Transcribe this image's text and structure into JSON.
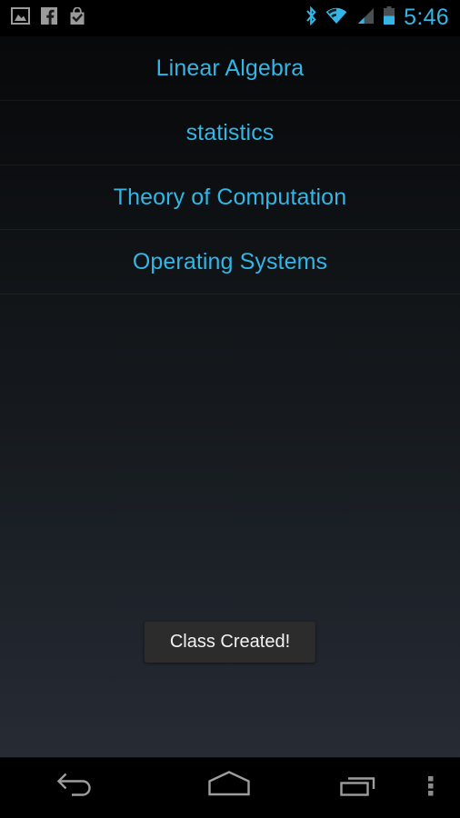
{
  "status_bar": {
    "notifications": [
      {
        "name": "photo-icon",
        "label": "Screenshot captured"
      },
      {
        "name": "facebook-icon",
        "label": "Facebook"
      },
      {
        "name": "play-store-bag-check-icon",
        "label": "App installed"
      }
    ],
    "indicators": [
      {
        "name": "bluetooth-icon",
        "label": "Bluetooth on"
      },
      {
        "name": "wifi-icon",
        "label": "Wi-Fi connected"
      },
      {
        "name": "cellular-signal-icon",
        "label": "Cellular signal"
      },
      {
        "name": "battery-icon",
        "label": "Battery"
      }
    ],
    "clock": "5:46",
    "accent_color": "#33b5e5",
    "notification_icon_color": "#9b9b9b"
  },
  "class_list": {
    "items": [
      {
        "label": "Linear Algebra"
      },
      {
        "label": "statistics"
      },
      {
        "label": "Theory of Computation"
      },
      {
        "label": "Operating Systems"
      }
    ],
    "item_text_color": "#33b5e5"
  },
  "toast": {
    "message": "Class Created!",
    "background_color": "#2c2c2c",
    "text_color": "#f2f2f2"
  },
  "nav_bar": {
    "buttons": [
      {
        "name": "back-button",
        "label": "Back"
      },
      {
        "name": "home-button",
        "label": "Home"
      },
      {
        "name": "recents-button",
        "label": "Recent apps"
      },
      {
        "name": "overflow-menu-button",
        "label": "More options"
      }
    ],
    "icon_color": "#9e9e9e"
  }
}
